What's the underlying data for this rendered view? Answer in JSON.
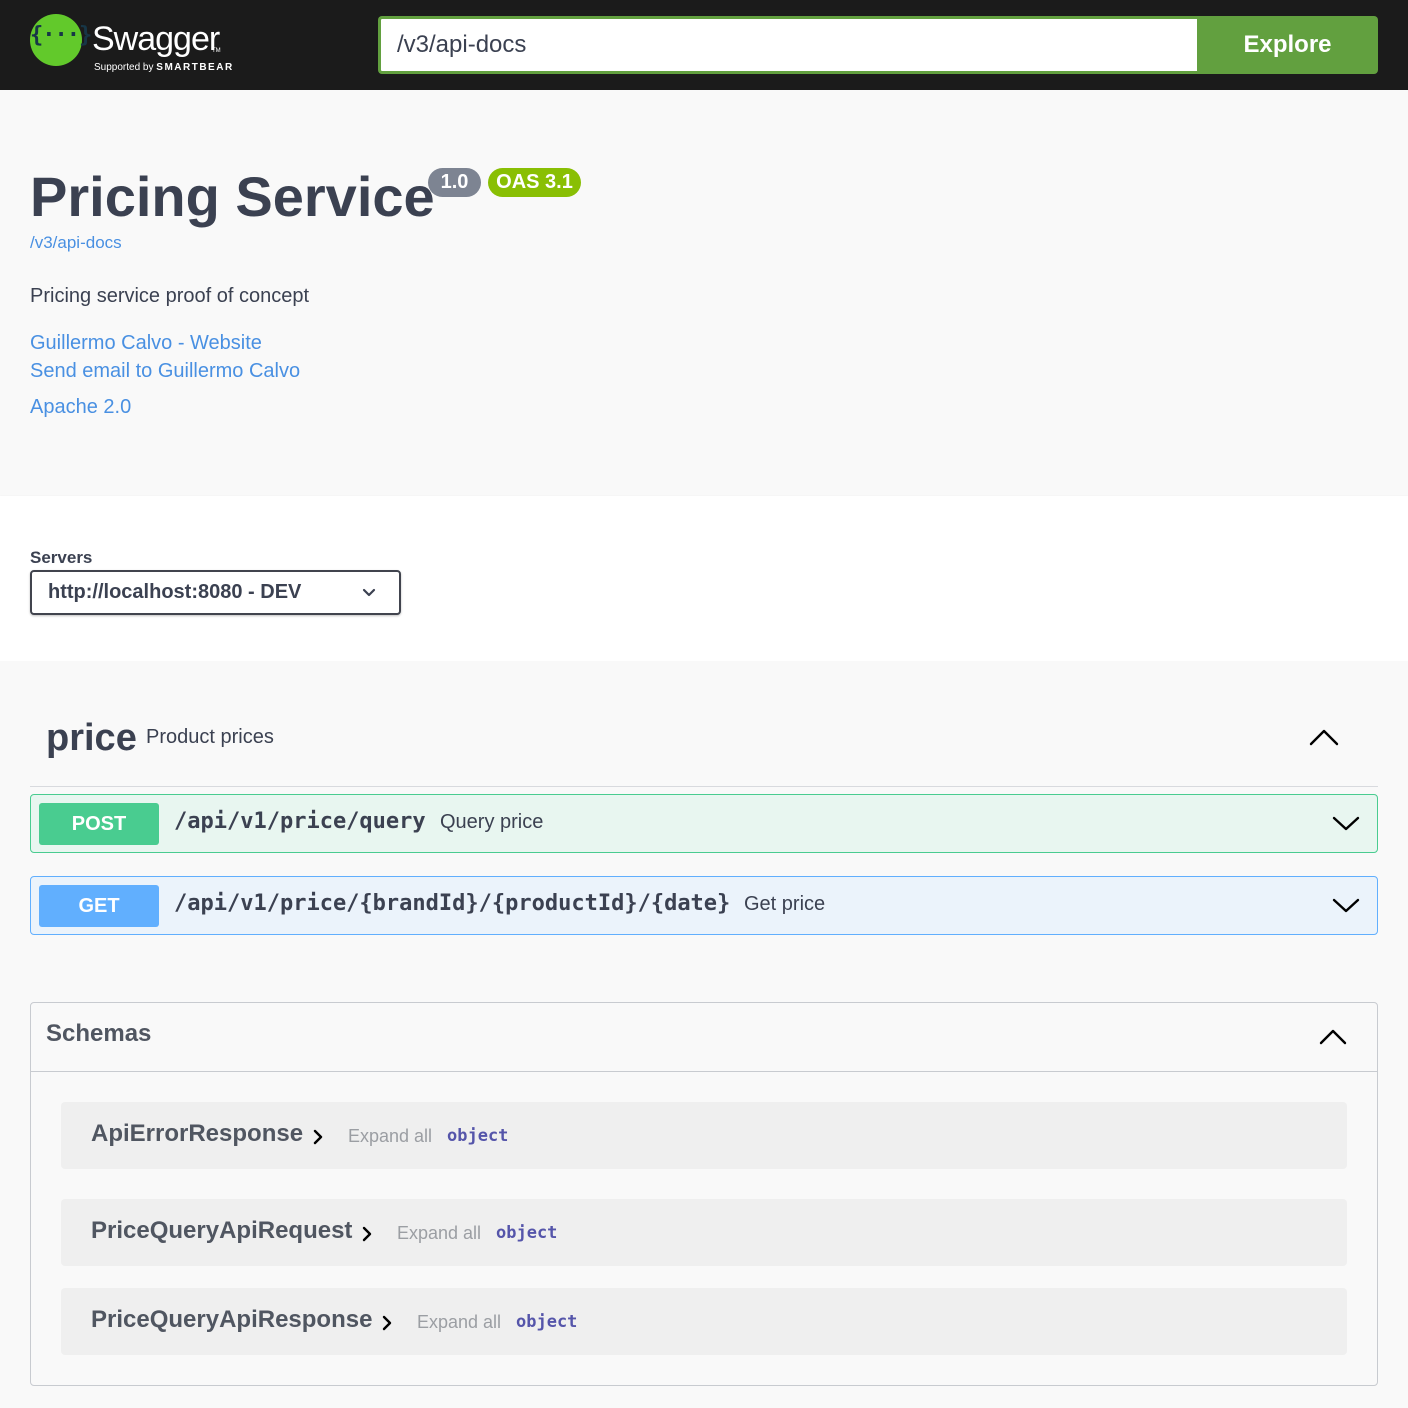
{
  "header": {
    "logo_name": "Swagger",
    "logo_tm": "TM",
    "logo_supported": "Supported by",
    "logo_company": "SMARTBEAR",
    "url_value": "/v3/api-docs",
    "explore_label": "Explore"
  },
  "info": {
    "title": "Pricing Service",
    "version": "1.0",
    "oas": "OAS 3.1",
    "spec_link": "/v3/api-docs",
    "description": "Pricing service proof of concept",
    "contact_website": "Guillermo Calvo - Website",
    "contact_email": "Send email to Guillermo Calvo",
    "license": "Apache 2.0"
  },
  "servers": {
    "label": "Servers",
    "selected": "http://localhost:8080 - DEV"
  },
  "tag": {
    "name": "price",
    "description": "Product prices"
  },
  "operations": [
    {
      "method": "POST",
      "path": "/api/v1/price/query",
      "summary": "Query price"
    },
    {
      "method": "GET",
      "path": "/api/v1/price/{brandId}/{productId}/{date}",
      "summary": "Get price"
    }
  ],
  "schemas": {
    "title": "Schemas",
    "models": [
      {
        "name": "ApiErrorResponse",
        "expand": "Expand all",
        "type": "object"
      },
      {
        "name": "PriceQueryApiRequest",
        "expand": "Expand all",
        "type": "object"
      },
      {
        "name": "PriceQueryApiResponse",
        "expand": "Expand all",
        "type": "object"
      }
    ]
  },
  "colors": {
    "topbar": "#1b1b1b",
    "brand_green": "#62a03f",
    "logo_green": "#62c92b",
    "link": "#4990e2",
    "post": "#49cc90",
    "get": "#61affe",
    "version_badge": "#7d8492",
    "oas_badge": "#89bf04"
  },
  "icons": [
    "swagger-logo-icon",
    "chevron-down-icon",
    "chevron-up-icon",
    "chevron-right-icon"
  ]
}
